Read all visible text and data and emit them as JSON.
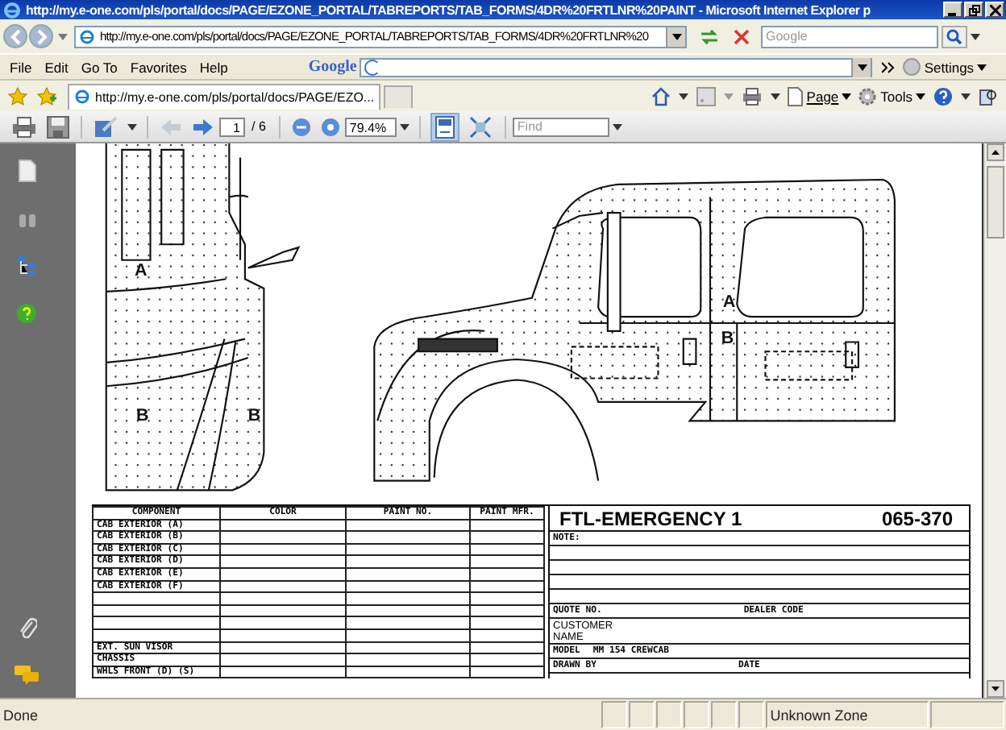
{
  "window": {
    "title": "http://my.e-one.com/pls/portal/docs/PAGE/EZONE_PORTAL/TABREPORTS/TAB_FORMS/4DR%20FRTLNR%20PAINT - Microsoft Internet Explorer p"
  },
  "address_bar": {
    "value": "http://my.e-one.com/pls/portal/docs/PAGE/EZONE_PORTAL/TABREPORTS/TAB_FORMS/4DR%20FRTLNR%20"
  },
  "search": {
    "placeholder": "Google"
  },
  "menu": [
    "File",
    "Edit",
    "Go To",
    "Favorites",
    "Help"
  ],
  "google_toolbar": {
    "logo": "Google",
    "settings": "Settings"
  },
  "tabs": [
    {
      "label": "http://my.e-one.com/pls/portal/docs/PAGE/EZO...",
      "selected": true
    }
  ],
  "command_bar": [
    "Page",
    "Tools"
  ],
  "pdf_toolbar": {
    "page": "1",
    "page_count": "/ 6",
    "zoom": "79.4%",
    "find_placeholder": "Find",
    "page_nav": [
      {
        "disabled": true
      },
      {
        "disabled": false
      }
    ],
    "view_buttons": [
      {
        "selected": true
      },
      {
        "selected": false
      }
    ]
  },
  "drawing": {
    "labels": [
      "A",
      "B",
      "B",
      "A",
      "B"
    ]
  },
  "form": {
    "columns": [
      "COMPONENT",
      "COLOR",
      "PAINT NO.",
      "PAINT MFR."
    ],
    "rows": [
      {
        "kind": "entry",
        "component": "CAB EXTERIOR (A)"
      },
      {
        "kind": "entry",
        "component": "CAB EXTERIOR (B)"
      },
      {
        "kind": "entry",
        "component": "CAB EXTERIOR (C)"
      },
      {
        "kind": "entry",
        "component": "CAB EXTERIOR (D)"
      },
      {
        "kind": "entry",
        "component": "CAB EXTERIOR (E)"
      },
      {
        "kind": "entry",
        "component": "CAB EXTERIOR (F)"
      },
      {
        "kind": "blank"
      },
      {
        "kind": "blank"
      },
      {
        "kind": "blank"
      },
      {
        "kind": "blank"
      },
      {
        "kind": "entry",
        "component": "EXT. SUN VISOR"
      },
      {
        "kind": "entry",
        "component": "CHASSIS"
      },
      {
        "kind": "entry",
        "component": "WHLS FRONT (D) (S)"
      }
    ],
    "title": "FTL-EMERGENCY 1",
    "number": "065-370",
    "note_label": "NOTE:",
    "quote_label": "QUOTE NO.",
    "dealer_label": "DEALER CODE",
    "customer_label": "CUSTOMER NAME",
    "model_label": "MODEL",
    "model_value": "MM 154 CREWCAB",
    "drawn_by_label": "DRAWN BY",
    "date_label": "DATE"
  },
  "status_bar": {
    "text": "Done",
    "zone": "Unknown Zone"
  }
}
